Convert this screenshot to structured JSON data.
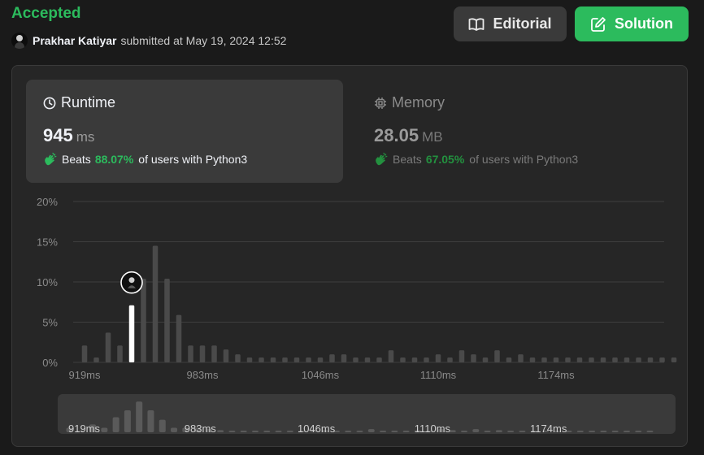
{
  "header": {
    "status": "Accepted",
    "username": "Prakhar Katiyar",
    "submitted_text": "submitted at May 19, 2024 12:52",
    "editorial_label": "Editorial",
    "solution_label": "Solution"
  },
  "runtime": {
    "title": "Runtime",
    "value": "945",
    "unit": "ms",
    "beats_label": "Beats",
    "beats_pct": "88.07%",
    "beats_suffix": "of users with Python3"
  },
  "memory": {
    "title": "Memory",
    "value": "28.05",
    "unit": "MB",
    "beats_label": "Beats",
    "beats_pct": "67.05%",
    "beats_suffix": "of users with Python3"
  },
  "colors": {
    "accepted": "#2cbb5d",
    "bar": "#4a4a4a",
    "highlight": "#ffffff",
    "grid": "#3e3e3e"
  },
  "chart_data": {
    "type": "bar",
    "y_ticks": [
      "0%",
      "5%",
      "10%",
      "15%",
      "20%"
    ],
    "ylim": [
      0,
      20
    ],
    "x_tick_labels": [
      "919ms",
      "983ms",
      "1046ms",
      "1110ms",
      "1174ms"
    ],
    "x_tick_bins": [
      0,
      10,
      20,
      30,
      40
    ],
    "highlight_bin": 4,
    "grid": true,
    "values": [
      2.1,
      0.6,
      3.7,
      2.1,
      7.1,
      10.4,
      14.5,
      10.4,
      5.9,
      2.1,
      2.1,
      2.1,
      1.6,
      1.0,
      0.6,
      0.6,
      0.6,
      0.6,
      0.6,
      0.6,
      0.6,
      1.0,
      1.0,
      0.6,
      0.6,
      0.6,
      1.5,
      0.6,
      0.6,
      0.6,
      1.0,
      0.6,
      1.5,
      1.0,
      0.6,
      1.5,
      0.6,
      1.0,
      0.6,
      0.6,
      0.6,
      0.6,
      0.6,
      0.6,
      0.6,
      0.6,
      0.6,
      0.6,
      0.6,
      0.6,
      0.6
    ]
  }
}
